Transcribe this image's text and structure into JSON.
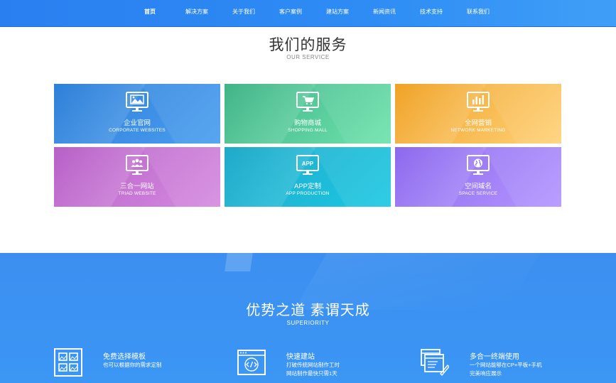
{
  "nav": {
    "items": [
      {
        "label": "首页",
        "active": true
      },
      {
        "label": "解决方案",
        "active": false
      },
      {
        "label": "关于我们",
        "active": false
      },
      {
        "label": "客户案例",
        "active": false
      },
      {
        "label": "建站方案",
        "active": false
      },
      {
        "label": "新闻资讯",
        "active": false
      },
      {
        "label": "技术支持",
        "active": false
      },
      {
        "label": "联系我们",
        "active": false
      }
    ]
  },
  "service": {
    "title": "我们的服务",
    "subtitle": "OUR SERVICE",
    "cards": [
      {
        "cn": "企业官网",
        "en": "CORPORATE WEBSITES",
        "icon": "image-monitor-icon",
        "color": "#2d7fd8"
      },
      {
        "cn": "购物商城",
        "en": "SHOPPING MALL",
        "icon": "cart-monitor-icon",
        "color": "#3fb487"
      },
      {
        "cn": "全网营销",
        "en": "NETWORK MARKETING",
        "icon": "chart-monitor-icon",
        "color": "#f0a225"
      },
      {
        "cn": "三合一网站",
        "en": "TRIAD WEBSITE",
        "icon": "users-monitor-icon",
        "color": "#b75fc7"
      },
      {
        "cn": "APP定制",
        "en": "APP PRODUCTION",
        "icon": "app-monitor-icon",
        "icon_text": "APP",
        "color": "#1ea9c9"
      },
      {
        "cn": "空间域名",
        "en": "SPACE SERVICE",
        "icon": "globe-monitor-icon",
        "color": "#8c68ee"
      }
    ]
  },
  "superiority": {
    "title": "优势之道 素谓天成",
    "subtitle": "SUPERIORITY",
    "features": [
      {
        "title": "免费选择模板",
        "desc1": "也可以根据你的需求定制",
        "desc2": "",
        "icon": "template-grid-icon"
      },
      {
        "title": "快速建站",
        "desc1": "打破传统网站制作工时",
        "desc2": "网站制作最快只需1天",
        "icon": "code-window-icon"
      },
      {
        "title": "多合一终端使用",
        "desc1": "一个网站能够在CP+平板+手机",
        "desc2": "完美响应展示",
        "icon": "multi-window-icon"
      }
    ]
  }
}
